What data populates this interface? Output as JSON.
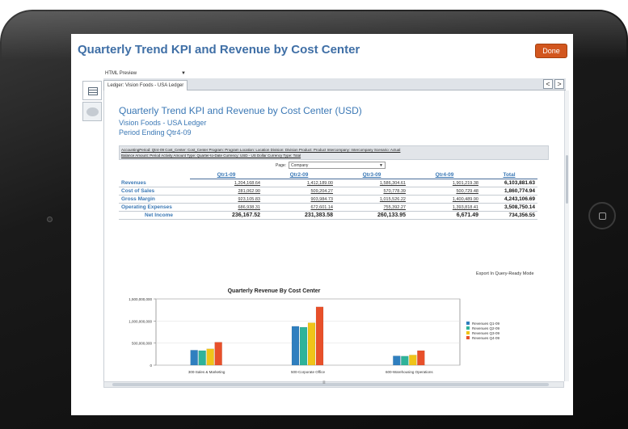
{
  "app": {
    "title": "Quarterly Trend KPI and Revenue by Cost Center",
    "done_label": "Done",
    "preview_mode": "HTML Preview",
    "ledger_tab": "Ledger: Vision Foods - USA Ledger",
    "nav_prev": "<",
    "nav_next": ">"
  },
  "report": {
    "title": "Quarterly Trend KPI and Revenue by Cost Center (USD)",
    "subtitle": "Vision Foods - USA Ledger",
    "period": "Period Ending Qtr4-09",
    "pov_line1": "AccountingPeriod: Qtr4-09 Cost_Center: Cost_Center Program: Program Location: Location Division: Division Product: Product Intercompany: Intercompany Scenario: Actual",
    "pov_line2": "Balance Amount: Period Activity Amount Type: Quarter-to-Date Currency: USD - US Dollar Currency Type: Total",
    "page_label": "Page:",
    "page_value": "Company",
    "export_label": "Export In Query-Ready Mode"
  },
  "grid": {
    "columns": [
      "Qtr1-09",
      "Qtr2-09",
      "Qtr3-09",
      "Qtr4-09",
      "Total"
    ],
    "rows": [
      {
        "label": "Revenues",
        "values": [
          "1,204,168.64",
          "1,412,189.00",
          "1,586,304.61",
          "1,901,219.38",
          "6,103,881.63"
        ]
      },
      {
        "label": "Cost of Sales",
        "values": [
          "281,062.90",
          "509,204.27",
          "570,778.39",
          "500,729.48",
          "1,860,774.94"
        ]
      },
      {
        "label": "Gross Margin",
        "values": [
          "923,105.83",
          "903,984.73",
          "1,015,526.22",
          "1,400,489.90",
          "4,243,106.69"
        ]
      },
      {
        "label": "Operating Expenses",
        "values": [
          "686,938.31",
          "672,601.14",
          "755,392.27",
          "1,393,818.41",
          "3,508,750.14"
        ]
      },
      {
        "label": "Net Income",
        "values": [
          "236,167.52",
          "231,383.58",
          "260,133.95",
          "6,671.49",
          "734,356.55"
        ]
      }
    ]
  },
  "chart_data": {
    "type": "bar",
    "title": "Quarterly Revenue By Cost Center",
    "categories": [
      "300-Sales & Marketing",
      "500-Corporate Office",
      "600-Warehousing Operations"
    ],
    "y_ticks": [
      "1,500,000,000",
      "1,000,000,000",
      "500,000,000",
      "0"
    ],
    "ylim": [
      0,
      1500000000
    ],
    "legend_position": "right",
    "series": [
      {
        "name": "Revenues Q1-09",
        "color": "#2f7fbf",
        "values": [
          340000000,
          880000000,
          210000000
        ]
      },
      {
        "name": "Revenues Q2-09",
        "color": "#2fb39a",
        "values": [
          330000000,
          860000000,
          205000000
        ]
      },
      {
        "name": "Revenues Q3-09",
        "color": "#f0c419",
        "values": [
          370000000,
          960000000,
          230000000
        ]
      },
      {
        "name": "Revenues Q4-09",
        "color": "#e8502a",
        "values": [
          520000000,
          1320000000,
          330000000
        ]
      }
    ]
  }
}
